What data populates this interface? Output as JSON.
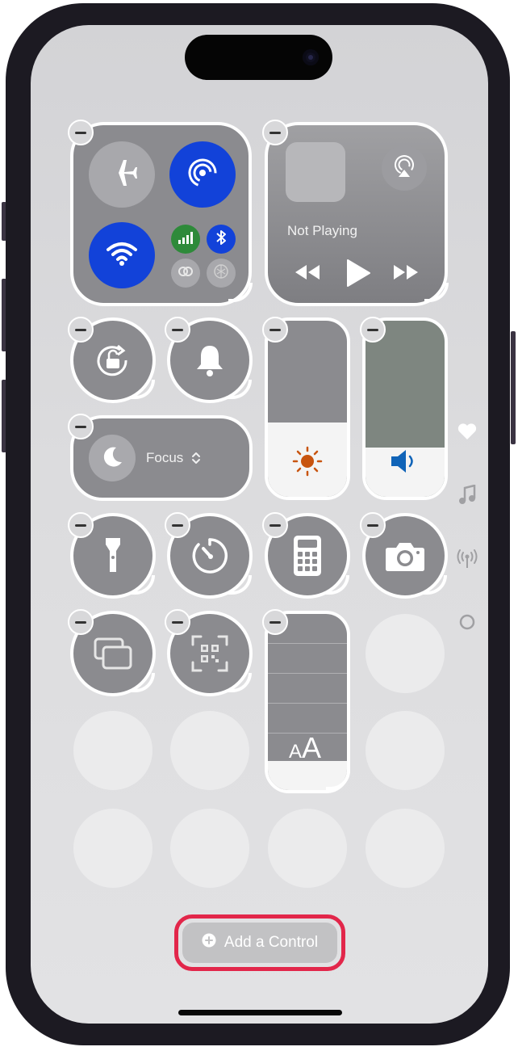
{
  "media": {
    "status": "Not Playing"
  },
  "focus": {
    "label": "Focus"
  },
  "add_control": {
    "label": "Add a Control"
  },
  "text_size": {
    "label": "AA"
  },
  "colors": {
    "connectivity_active": "#1242d9",
    "cellular": "#2e8a3a",
    "highlight_border": "#e2264a",
    "tile_gray": "#8b8b8f",
    "brightness_sun": "#c8540f",
    "volume_speaker": "#1064b8"
  },
  "icons": [
    "airplane-icon",
    "airdrop-icon",
    "wifi-icon",
    "cellular-icon",
    "bluetooth-icon",
    "link-icon",
    "satellite-icon",
    "airplay-icon",
    "rewind-icon",
    "play-icon",
    "fast-forward-icon",
    "orientation-lock-icon",
    "bell-icon",
    "sun-icon",
    "speaker-icon",
    "moon-icon",
    "chevron-updown-icon",
    "flashlight-icon",
    "timer-icon",
    "calculator-icon",
    "camera-icon",
    "screen-mirroring-icon",
    "qr-code-icon",
    "heart-icon",
    "music-note-icon",
    "antenna-icon",
    "circle-icon",
    "plus-circle-icon"
  ],
  "sliders": {
    "brightness_level": 0.42,
    "volume_level": 0.28
  }
}
